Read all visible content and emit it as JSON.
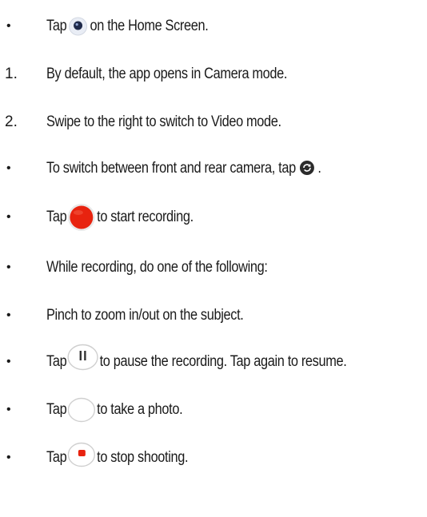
{
  "steps": [
    {
      "marker": "•",
      "before": "Tap",
      "icon": "camera-app-icon",
      "after": "on the Home Screen."
    },
    {
      "marker": "1.",
      "text": "By default, the app opens in Camera mode."
    },
    {
      "marker": "2.",
      "text": "Swipe to the right to switch to Video mode."
    },
    {
      "marker": "•",
      "before": "To switch between front and rear camera, tap",
      "icon": "switch-camera-icon",
      "after": "."
    },
    {
      "marker": "•",
      "before": "Tap",
      "icon": "record-button-icon",
      "after": "to start recording."
    },
    {
      "marker": "•",
      "text": "While recording, do one of the following:"
    },
    {
      "marker": "•",
      "text": "Pinch to zoom in/out on the subject."
    },
    {
      "marker": "•",
      "before": "Tap",
      "icon": "pause-button-icon",
      "after": "to pause the recording. Tap again to resume."
    },
    {
      "marker": "•",
      "before": "Tap",
      "icon": "shutter-button-icon",
      "after": "to take a photo."
    },
    {
      "marker": "•",
      "before": "Tap",
      "icon": "stop-button-icon",
      "after": "to stop shooting."
    }
  ],
  "colors": {
    "text": "#1a1a1a",
    "record_red": "#e8230f",
    "icon_gray": "#c8c8c8",
    "icon_dark": "#3a3a3a"
  }
}
